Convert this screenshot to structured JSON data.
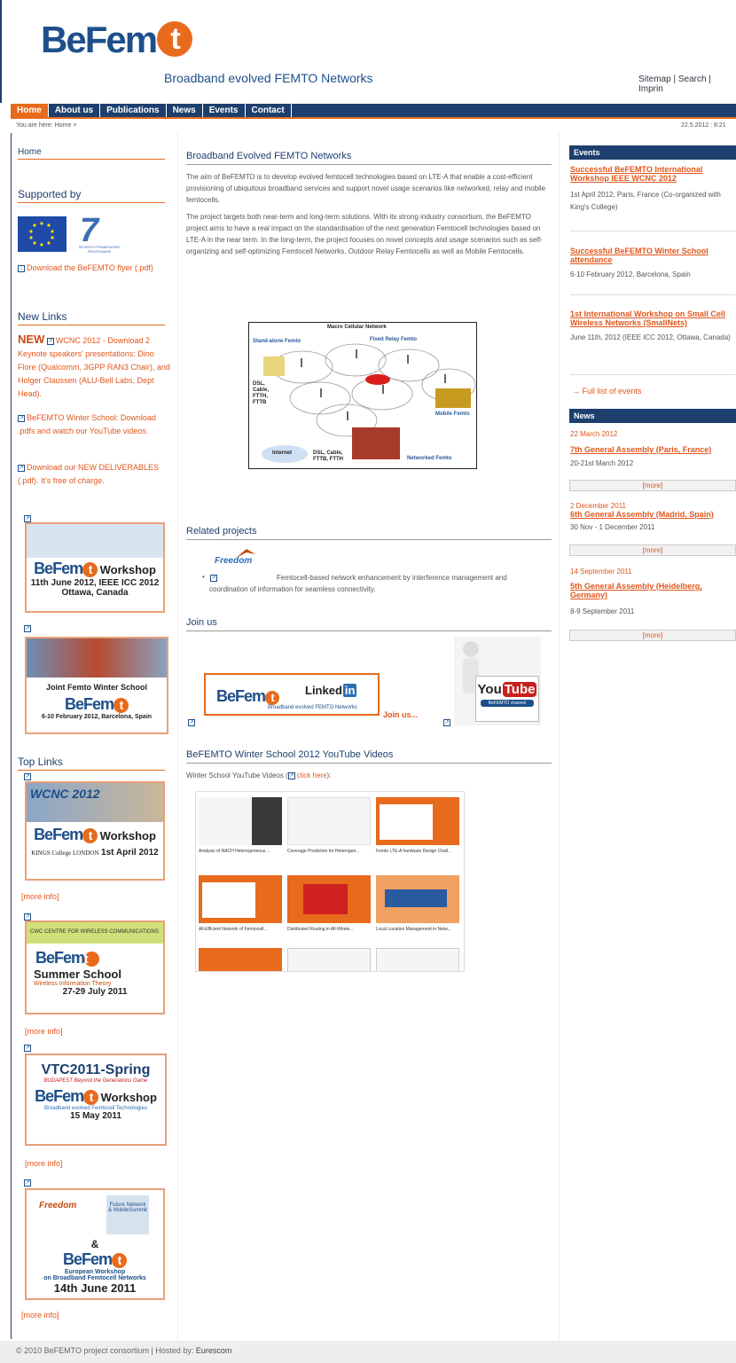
{
  "header": {
    "logo_text": "BeFemto",
    "tagline": "Broadband evolved FEMTO Networks",
    "toplinks": "Sitemap | Search | Imprin"
  },
  "nav": {
    "items": [
      "Home",
      "About us",
      "Publications",
      "News",
      "Events",
      "Contact"
    ]
  },
  "breadcrumb": "You are here: Home >",
  "datetime": "22.5.2012 : 8:21",
  "left": {
    "home": "Home",
    "supported_by": "Supported by",
    "fp7_text": "SEVENTH FRAMEWORK PROGRAMME",
    "flyer": "Download the BeFEMTO flyer (.pdf)",
    "new_links_title": "New Links",
    "new_badge": "NEW",
    "new_links": [
      "WCNC 2012 - Download 2 Keynote speakers' presentations: Dino Flore (Qualcomm, 3GPP RAN3 Chair), and Holger Claussen (ALU-Bell Labs, Dept Head).",
      "BeFEMTO Winter School: Download .pdfs and watch our YouTube videos.",
      "Download our NEW DELIVERABLES (.pdf). It's free of charge."
    ],
    "banner1": {
      "title": "Workshop",
      "line1": "11th June 2012, IEEE ICC 2012",
      "line2": "Ottawa, Canada"
    },
    "banner2": {
      "title": "Joint Femto Winter School",
      "line1": "6-10 February 2012, Barcelona, Spain"
    },
    "top_links_title": "Top Links",
    "banner3": {
      "top": "WCNC 2012",
      "title": "Workshop",
      "line1": "1st April 2012",
      "kings": "KINGS College LONDON"
    },
    "banner4": {
      "top": "CWC CENTRE FOR WIRELESS COMMUNICATIONS",
      "title": "Summer School",
      "sub": "Wireless Information Theory",
      "line1": "27-29 July 2011"
    },
    "banner5": {
      "top": "VTC2011-Spring",
      "sub_top": "BUDAPEST Beyond the Generations Game",
      "title": "Workshop",
      "sub": "Broadband evolved Femtocell Technologies",
      "line1": "15 May 2011"
    },
    "banner6": {
      "top": "Future Network & MobileSummit",
      "amp": "&",
      "line1": "European Workshop",
      "line2": "on Broadband Femtocell Networks",
      "line3": "14th June 2011"
    },
    "more_info": "[more info]"
  },
  "center": {
    "title": "Broadband Evolved FEMTO Networks",
    "p1": "The aim of BeFEMTO is to develop evolved femtocell technologies based on LTE-A that enable a cost-efficient provisioning of ubiquitous broadband services and support novel usage scenarios like networked, relay and mobile femtocells.",
    "p2": "The project targets both near-term and long-term solutions. With its strong industry consortium, the BeFEMTO project aims to have a real impact on the standardisation of the next generation Femtocell technologies based on LTE-A in the near term. In the long-term, the project focuses on novel concepts and usage scenarios such as self-organizing and self-optimizing Femtocell Networks, Outdoor Relay Femtocells as well as Mobile Femtocells.",
    "diagram": {
      "title": "Macro Cellular Network",
      "standalone": "Stand-alone Femto",
      "fixed_relay": "Fixed Relay Femto",
      "dsl": "DSL, Cable, FTTH, FTTB",
      "mobile": "Mobile Femto",
      "internet": "Internet",
      "dsl2": "DSL, Cable, FTTB, FTTH",
      "networked": "Networked Femto"
    },
    "related_title": "Related projects",
    "related_text": "Femtocell-based network enhancement by interference management and coordination of information for seamless connectivity.",
    "freedom": "Freedom",
    "join_title": "Join us",
    "linkedin_label": "Linked",
    "linkedin_in": "in",
    "linkedin_sub": "Broadband evolved FEMTO Networks",
    "join_us": "Join us...",
    "youtube_you": "You",
    "youtube_tube": "Tube",
    "youtube_channel": "BeFEMTO channel",
    "yt_title": "BeFEMTO Winter School 2012 YouTube Videos",
    "yt_text_pre": "Winter School YouTube Videos (",
    "yt_link": "click here",
    "yt_text_post": "):",
    "videos": [
      "Analysis of RACH Heterogeneous ...",
      "Coverage Prediction for Heterogen...",
      "Femto LTE-A hardware Design Chall...",
      "All-Efficient Network of Femtocell...",
      "Distributed Routing in All-Wirele...",
      "Local Location Management in Netw..."
    ]
  },
  "right": {
    "events_title": "Events",
    "events": [
      {
        "title": "Successful BeFEMTO International Workshop IEEE WCNC 2012",
        "text": "1st April 2012, Paris, France (Co-organized with King's College)"
      },
      {
        "title": "Successful BeFEMTO Winter School attendance",
        "text": "6-10 February 2012, Barcelona, Spain"
      },
      {
        "title": "1st International Workshop on Small Cell Wireless Networks (SmallNets)",
        "text": "June 11th, 2012 (IEEE ICC 2012, Ottawa, Canada)"
      }
    ],
    "full_list": "Full list of events",
    "news_title": "News",
    "news": [
      {
        "date": "22 March 2012",
        "title": "7th General Assembly (Paris, France)",
        "text": "20-21st March 2012"
      },
      {
        "date": "2 December 2011",
        "title": "6th General Assembly (Madrid, Spain)",
        "text": "30 Nov - 1 December 2011"
      },
      {
        "date": "14 September 2011",
        "title": "5th General Assembly (Heidelberg, Germany)",
        "text": "8-9 September 2011"
      }
    ],
    "more": "[more]"
  },
  "footer": {
    "copyright": "© 2010 BeFEMTO project consortium | Hosted by: ",
    "host": "Eurescom"
  }
}
